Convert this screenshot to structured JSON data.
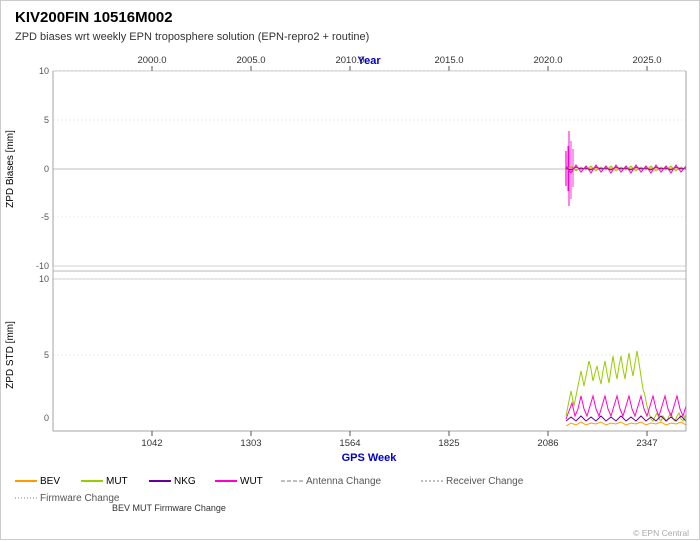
{
  "title": "KIV200FIN 10516M002",
  "subtitle": "ZPD biases wrt weekly EPN troposphere solution (EPN-repro2 + routine)",
  "year_axis_label": "Year",
  "gps_week_label": "GPS Week",
  "zpd_biases_label": "ZPD Biases [mm]",
  "zpd_std_label": "ZPD STD [mm]",
  "year_ticks": [
    "2000.0",
    "2005.0",
    "2010.0",
    "2015.0",
    "2020.0",
    "2025.0"
  ],
  "gps_week_ticks": [
    "1042",
    "1303",
    "1564",
    "1825",
    "2086",
    "2347"
  ],
  "bias_yticks": [
    "10",
    "5",
    "0",
    "-5",
    "-10"
  ],
  "std_yticks": [
    "10",
    "5",
    "0"
  ],
  "legend": {
    "bev": {
      "label": "BEV",
      "color": "#ff9900"
    },
    "mut": {
      "label": "MUT",
      "color": "#99cc00"
    },
    "nkg": {
      "label": "NKG",
      "color": "#660099"
    },
    "wut": {
      "label": "WUT",
      "color": "#ff00cc"
    },
    "antenna_change": {
      "label": "Antenna Change",
      "color": "#aaaaaa"
    },
    "receiver_change": {
      "label": "Receiver Change",
      "color": "#aaaaaa"
    },
    "firmware_change": {
      "label": "Firmware Change",
      "color": "#aaaaaa"
    }
  },
  "annotations": {
    "bev_mut_firmware": "BEV MUT Firmware Change"
  },
  "copyright": "© EPN Central"
}
